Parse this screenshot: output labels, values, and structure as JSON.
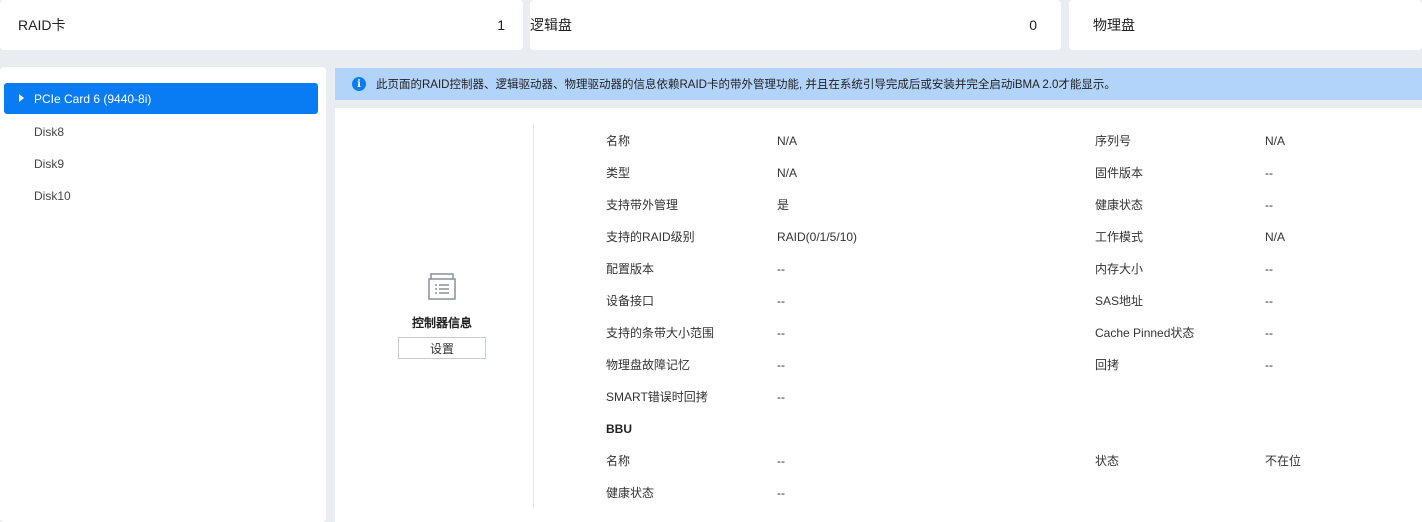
{
  "summary": {
    "raid_label": "RAID卡",
    "raid_count": "1",
    "logical_label": "逻辑盘",
    "logical_count": "0",
    "physical_label": "物理盘"
  },
  "sidebar": {
    "items": [
      {
        "label": "PCIe Card 6 (9440-8i)",
        "selected": true
      },
      {
        "label": "Disk8"
      },
      {
        "label": "Disk9"
      },
      {
        "label": "Disk10"
      }
    ]
  },
  "notice": {
    "icon": "info-icon",
    "text": "此页面的RAID控制器、逻辑驱动器、物理驱动器的信息依赖RAID卡的带外管理功能, 并且在系统引导完成后或安装并完全启动iBMA 2.0才能显示。"
  },
  "controller": {
    "icon": "controller-info-icon",
    "title": "控制器信息",
    "settings_label": "设置",
    "left": [
      {
        "k": "名称",
        "v": "N/A"
      },
      {
        "k": "类型",
        "v": "N/A"
      },
      {
        "k": "支持带外管理",
        "v": "是"
      },
      {
        "k": "支持的RAID级别",
        "v": "RAID(0/1/5/10)"
      },
      {
        "k": "配置版本",
        "v": "--"
      },
      {
        "k": "设备接口",
        "v": "--"
      },
      {
        "k": "支持的条带大小范围",
        "v": "--"
      },
      {
        "k": "物理盘故障记忆",
        "v": "--"
      },
      {
        "k": "SMART错误时回拷",
        "v": "--"
      }
    ],
    "right": [
      {
        "k": "序列号",
        "v": "N/A"
      },
      {
        "k": "固件版本",
        "v": "--"
      },
      {
        "k": "健康状态",
        "v": "--"
      },
      {
        "k": "工作模式",
        "v": "N/A"
      },
      {
        "k": "内存大小",
        "v": "--"
      },
      {
        "k": "SAS地址",
        "v": "--"
      },
      {
        "k": "Cache Pinned状态",
        "v": "--"
      },
      {
        "k": "回拷",
        "v": "--"
      }
    ],
    "bbu": {
      "title": "BBU",
      "left": [
        {
          "k": "名称",
          "v": "--"
        },
        {
          "k": "健康状态",
          "v": "--"
        }
      ],
      "right": [
        {
          "k": "状态",
          "v": "不在位"
        }
      ]
    }
  }
}
